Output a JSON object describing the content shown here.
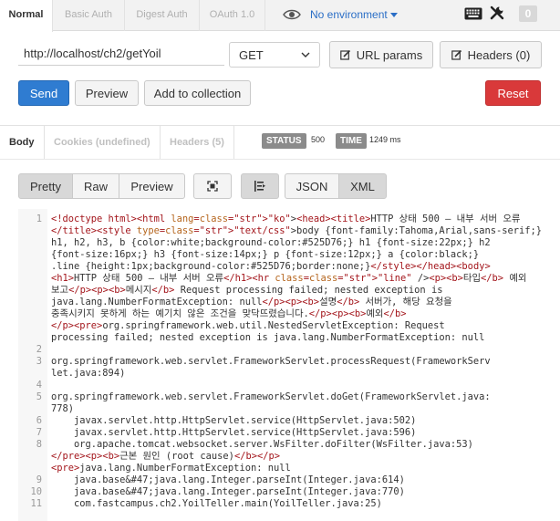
{
  "top_tabs": [
    "Normal",
    "Basic Auth",
    "Digest Auth",
    "OAuth 1.0"
  ],
  "environment": {
    "label": "No environment"
  },
  "badge": {
    "count": "0"
  },
  "request": {
    "url": "http://localhost/ch2/getYoil",
    "method": "GET",
    "url_params_label": "URL params",
    "headers_label": "Headers (0)"
  },
  "actions": {
    "send": "Send",
    "preview": "Preview",
    "add_collection": "Add to collection",
    "reset": "Reset"
  },
  "response": {
    "tabs": [
      "Body",
      "Cookies (undefined)",
      "Headers (5)"
    ],
    "status_label": "STATUS",
    "status_value": "500",
    "time_label": "TIME",
    "time_value": "1249 ms",
    "view_modes": [
      "Pretty",
      "Raw",
      "Preview"
    ],
    "formats": [
      "JSON",
      "XML"
    ]
  },
  "code_lines": [
    "<!doctype html><html lang=\"ko\"><head><title>HTTP 상태 500 – 내부 서버 오류",
    "</title><style type=\"text/css\">body {font-family:Tahoma,Arial,sans-serif;}",
    "h1, h2, h3, b {color:white;background-color:#525D76;} h1 {font-size:22px;} h2",
    "{font-size:16px;} h3 {font-size:14px;} p {font-size:12px;} a {color:black;}",
    ".line {height:1px;background-color:#525D76;border:none;}</style></head><body>",
    "<h1>HTTP 상태 500 – 내부 서버 오류</h1><hr class=\"line\" /><p><b>타입</b> 예외",
    "보고</p><p><b>메시지</b> Request processing failed; nested exception is",
    "java.lang.NumberFormatException: null</p><p><b>설명</b> 서버가, 해당 요청을",
    "충족시키지 못하게 하는 예기치 않은 조건을 맞닥뜨렸습니다.</p><p><b>예외</b>",
    "</p><pre>org.springframework.web.util.NestedServletException: Request",
    "processing failed; nested exception is java.lang.NumberFormatException: null",
    "",
    "org.springframework.web.servlet.FrameworkServlet.processRequest(FrameworkServ",
    "let.java:894)",
    "",
    "org.springframework.web.servlet.FrameworkServlet.doGet(FrameworkServlet.java:",
    "778)",
    "    javax.servlet.http.HttpServlet.service(HttpServlet.java:502)",
    "    javax.servlet.http.HttpServlet.service(HttpServlet.java:596)",
    "    org.apache.tomcat.websocket.server.WsFilter.doFilter(WsFilter.java:53)",
    "</pre><p><b>근본 원인 (root cause)</b></p>",
    "<pre>java.lang.NumberFormatException: null",
    "    java.base&#47;java.lang.Integer.parseInt(Integer.java:614)",
    "    java.base&#47;java.lang.Integer.parseInt(Integer.java:770)",
    "    com.fastcampus.ch2.YoilTeller.main(YoilTeller.java:25)",
    "",
    ""
  ],
  "line_numbers": [
    "1",
    "",
    "",
    "",
    "",
    "",
    "",
    "",
    "",
    "",
    "",
    "2",
    "3",
    "",
    "4",
    "5",
    "",
    "6",
    "7",
    "8",
    "",
    "",
    "9",
    "10",
    "11",
    "",
    ""
  ]
}
